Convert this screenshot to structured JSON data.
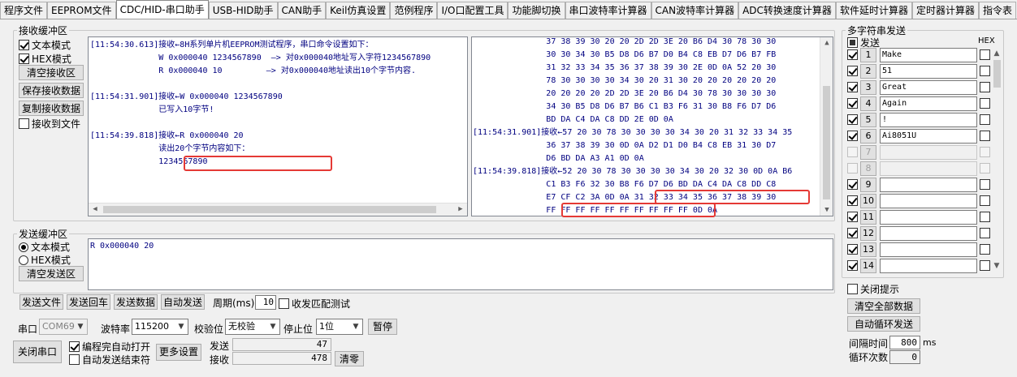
{
  "tabs": [
    "程序文件",
    "EEPROM文件",
    "CDC/HID-串口助手",
    "USB-HID助手",
    "CAN助手",
    "Keil仿真设置",
    "范例程序",
    "I/O口配置工具",
    "功能脚切换",
    "串口波特率计算器",
    "CAN波特率计算器",
    "ADC转换速度计算器",
    "软件延时计算器",
    "定时器计算器",
    "指令表"
  ],
  "active_tab": "CDC/HID-串口助手",
  "receive": {
    "title": "接收缓冲区",
    "text_mode": "文本模式",
    "hex_mode": "HEX模式",
    "clear_btn": "清空接收区",
    "save_btn": "保存接收数据",
    "copy_btn": "复制接收数据",
    "to_file": "接收到文件",
    "text_lines": [
      "[11:54:30.613]接收←8H系列单片机EEPROM测试程序，串口命令设置如下：",
      "              W 0x000040 1234567890  —> 对0x000040地址写入字符1234567890",
      "              R 0x000040 10         —> 对0x000040地址读出10个字节内容.",
      "",
      "[11:54:31.901]接收←W 0x000040 1234567890",
      "              已写入10字节!",
      "",
      "[11:54:39.818]接收←R 0x000040 20",
      "              读出20个字节内容如下：",
      "              1234567890"
    ],
    "hex_lines": [
      "               37 38 39 30 20 20 2D 2D 3E 20 B6 D4 30 78 30 30",
      "               30 30 34 30 B5 D8 D6 B7 D0 B4 C8 EB D7 D6 B7 FB",
      "               31 32 33 34 35 36 37 38 39 30 2E 0D 0A 52 20 30",
      "               78 30 30 30 30 34 30 20 31 30 20 20 20 20 20 20",
      "               20 20 20 20 2D 2D 3E 20 B6 D4 30 78 30 30 30 30",
      "               34 30 B5 D8 D6 B7 B6 C1 B3 F6 31 30 B8 F6 D7 D6",
      "               BD DA C4 DA C8 DD 2E 0D 0A",
      "[11:54:31.901]接收←57 20 30 78 30 30 30 30 34 30 20 31 32 33 34 35",
      "               36 37 38 39 30 0D 0A D2 D1 D0 B4 C8 EB 31 30 D7",
      "               D6 BD DA A3 A1 0D 0A",
      "[11:54:39.818]接收←52 20 30 78 30 30 30 30 34 30 20 32 30 0D 0A B6",
      "               C1 B3 F6 32 30 B8 F6 D7 D6 BD DA C4 DA C8 DD C8",
      "               E7 CF C2 3A 0D 0A 31 32 33 34 35 36 37 38 39 30",
      "               FF FF FF FF FF FF FF FF FF FF 0D 0A"
    ]
  },
  "send": {
    "title": "发送缓冲区",
    "text_mode": "文本模式",
    "hex_mode": "HEX模式",
    "clear_btn": "清空发送区",
    "content": "R 0x000040 20",
    "send_file": "发送文件",
    "send_enter": "发送回车",
    "send_data": "发送数据",
    "auto_send": "自动发送",
    "period_label": "周期(ms)",
    "period_value": "10",
    "match_test": "收发匹配测试"
  },
  "port": {
    "port_label": "串口",
    "port_value": "COM69",
    "baud_label": "波特率",
    "baud_value": "115200",
    "parity_label": "校验位",
    "parity_value": "无校验",
    "stop_label": "停止位",
    "stop_value": "1位",
    "pause_btn": "暂停",
    "close_btn": "关闭串口",
    "auto_open": "编程完自动打开",
    "auto_end": "自动发送结束符",
    "more_btn": "更多设置",
    "sent_label": "发送",
    "sent_value": "47",
    "recv_label": "接收",
    "recv_value": "478",
    "clear_btn": "清零"
  },
  "multi": {
    "title": "多字符串发送",
    "send_col": "发送",
    "hex_col": "HEX",
    "rows": [
      {
        "idx": "1",
        "text": "Make",
        "checked": true,
        "enabled": true
      },
      {
        "idx": "2",
        "text": "51",
        "checked": true,
        "enabled": true
      },
      {
        "idx": "3",
        "text": "Great",
        "checked": true,
        "enabled": true
      },
      {
        "idx": "4",
        "text": "Again",
        "checked": true,
        "enabled": true
      },
      {
        "idx": "5",
        "text": "!",
        "checked": true,
        "enabled": true
      },
      {
        "idx": "6",
        "text": "Ai8051U",
        "checked": true,
        "enabled": true
      },
      {
        "idx": "7",
        "text": "",
        "checked": false,
        "enabled": false
      },
      {
        "idx": "8",
        "text": "",
        "checked": false,
        "enabled": false
      },
      {
        "idx": "9",
        "text": "",
        "checked": true,
        "enabled": true
      },
      {
        "idx": "10",
        "text": "",
        "checked": true,
        "enabled": true
      },
      {
        "idx": "11",
        "text": "",
        "checked": true,
        "enabled": true
      },
      {
        "idx": "12",
        "text": "",
        "checked": true,
        "enabled": true
      },
      {
        "idx": "13",
        "text": "",
        "checked": true,
        "enabled": true
      },
      {
        "idx": "14",
        "text": "",
        "checked": true,
        "enabled": true
      }
    ],
    "close_hint": "关闭提示",
    "clear_all": "清空全部数据",
    "auto_loop": "自动循环发送",
    "interval_label": "间隔时间",
    "interval_value": "800",
    "interval_unit": "ms",
    "loop_label": "循环次数",
    "loop_value": "0"
  }
}
